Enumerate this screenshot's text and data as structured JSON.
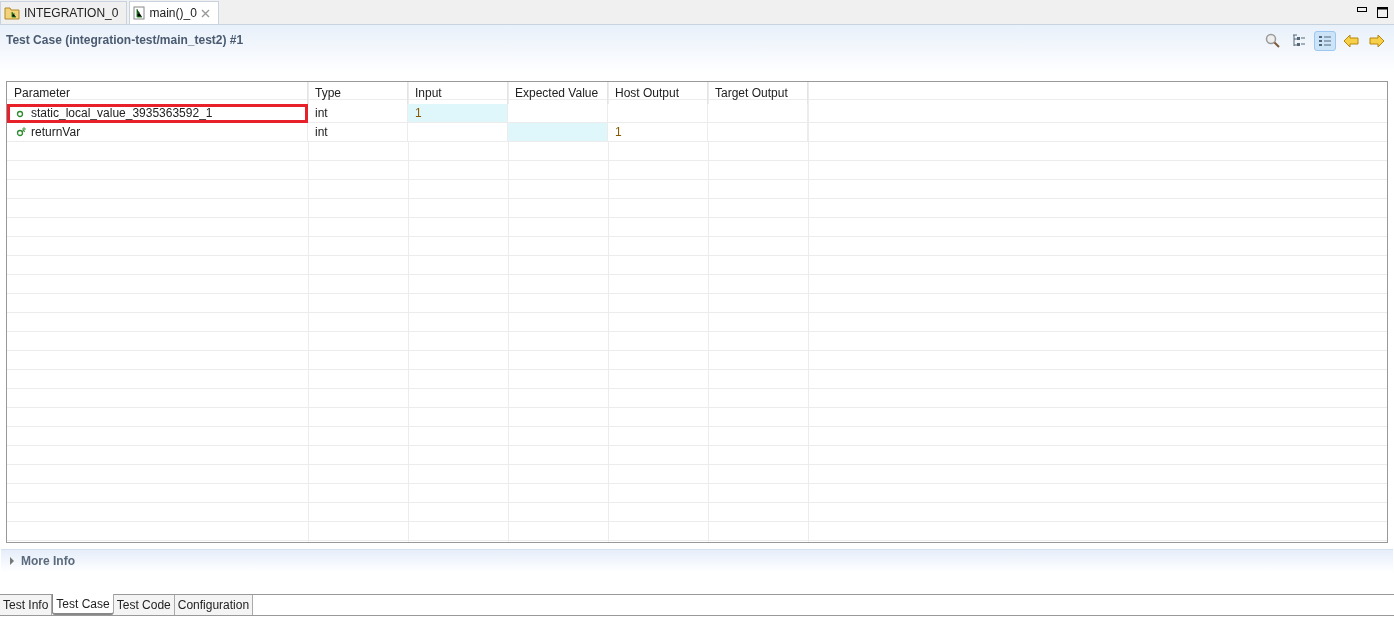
{
  "editor_tabs": [
    {
      "label": "INTEGRATION_0",
      "kind": "folder",
      "selected": false,
      "closable": false
    },
    {
      "label": "main()_0",
      "kind": "file",
      "selected": true,
      "closable": true
    }
  ],
  "header": {
    "title": "Test Case (integration-test/main_test2) #1",
    "toolbar": [
      {
        "kind": "search",
        "selected": false
      },
      {
        "kind": "tree",
        "selected": false
      },
      {
        "kind": "list",
        "selected": true
      },
      {
        "kind": "back",
        "selected": false
      },
      {
        "kind": "forward",
        "selected": false
      }
    ]
  },
  "table": {
    "columns": [
      "Parameter",
      "Type",
      "Input",
      "Expected Value",
      "Host Output",
      "Target Output"
    ],
    "rows": [
      {
        "kind": "local",
        "highlighted": true,
        "cells": [
          {
            "text": "static_local_value_3935363592_1",
            "editable": false
          },
          {
            "text": "int",
            "editable": false
          },
          {
            "text": "1",
            "editable": true
          },
          {
            "text": "",
            "editable": false
          },
          {
            "text": "",
            "editable": false
          },
          {
            "text": "",
            "editable": false
          }
        ]
      },
      {
        "kind": "return",
        "highlighted": false,
        "cells": [
          {
            "text": "returnVar",
            "editable": false
          },
          {
            "text": "int",
            "editable": false
          },
          {
            "text": "",
            "editable": false
          },
          {
            "text": "",
            "editable": true
          },
          {
            "text": "1",
            "editable": false
          },
          {
            "text": "",
            "editable": false
          }
        ]
      }
    ]
  },
  "more_info": {
    "label": "More Info",
    "expanded": false
  },
  "bottom_tabs": [
    {
      "label": "Test Info",
      "selected": false
    },
    {
      "label": "Test Case",
      "selected": true
    },
    {
      "label": "Test Code",
      "selected": false
    },
    {
      "label": "Configuration",
      "selected": false
    }
  ]
}
